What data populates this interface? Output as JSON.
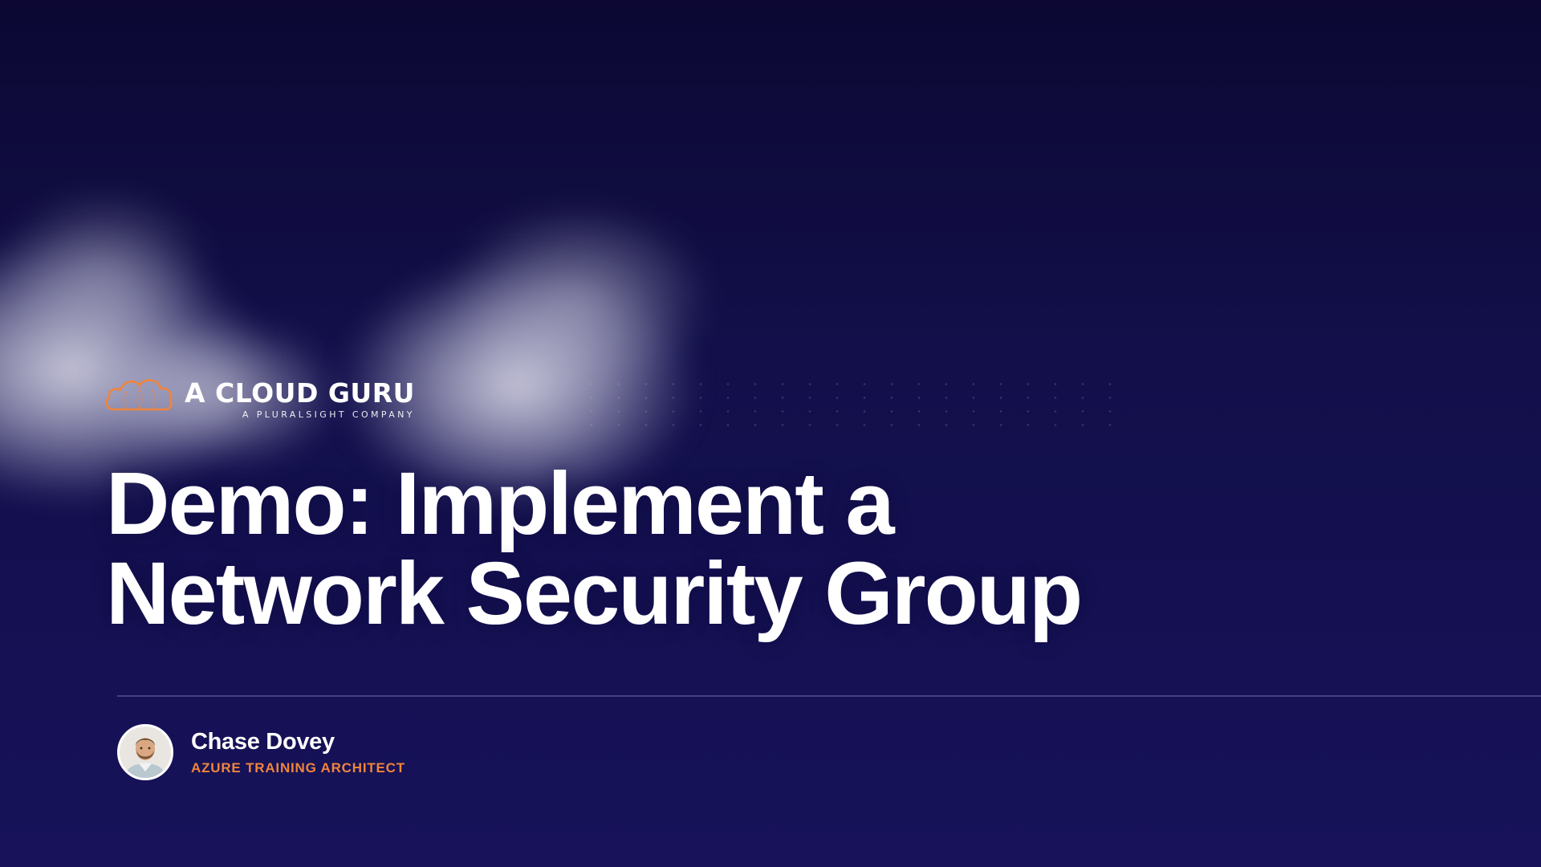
{
  "brand": {
    "name": "A CLOUD GURU",
    "tagline": "A PLURALSIGHT COMPANY",
    "accent_color": "#f0843c",
    "logo_icon": "cloud-icon"
  },
  "slide": {
    "title_line1": "Demo: Implement a",
    "title_line2": "Network Security Group",
    "background_color": "#120f4a"
  },
  "presenter": {
    "name": "Chase Dovey",
    "role": "AZURE TRAINING ARCHITECT",
    "avatar_icon": "avatar-photo"
  }
}
